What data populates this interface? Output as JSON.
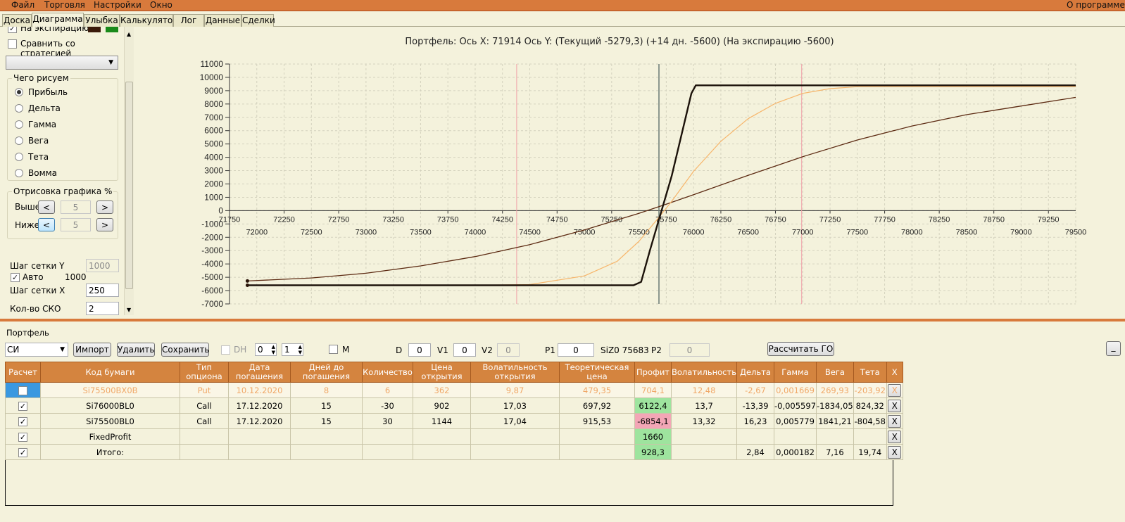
{
  "menu": {
    "file": "Файл",
    "trade": "Торговля",
    "settings": "Настройки",
    "window": "Окно",
    "about": "О программе"
  },
  "tabs": [
    "Доска",
    "Диаграмма",
    "Улыбка",
    "Калькулятор",
    "Лог",
    "Данные",
    "Сделки"
  ],
  "left": {
    "expiry_label": "На экспирацию",
    "compare_label": "Сравнить со стратегией",
    "what_group": "Чего рисуем",
    "radios": [
      "Прибыль",
      "Дельта",
      "Гамма",
      "Вега",
      "Тета",
      "Вомма"
    ],
    "draw_group": "Отрисовка графика %",
    "above_label": "Выше",
    "above_value": "5",
    "below_label": "Ниже",
    "below_value": "5",
    "prev": "<",
    "next": ">",
    "grid_y_label": "Шаг сетки Y",
    "grid_y_value": "1000",
    "auto_label": "Авто",
    "auto_value": "1000",
    "grid_x_label": "Шаг сетки X",
    "grid_x_value": "250",
    "sko_label": "Кол-во СКО",
    "sko_value": "2",
    "color_dark": "#3a1a0a",
    "color_green": "#1a8a1a"
  },
  "chart_title": "Портфель: Ось X: 71914 Ось Y:  (Текущий -5279,3)  (+14 дн. -5600)  (На экспирацию -5600)",
  "chart_data": {
    "type": "line",
    "xlim": [
      71750,
      79500
    ],
    "ylim": [
      -7000,
      11000
    ],
    "grid": true,
    "x_ticks_top": [
      "71750",
      "72250",
      "72750",
      "73250",
      "73750",
      "74250",
      "74750",
      "75250",
      "75750",
      "76250",
      "76750",
      "77250",
      "77750",
      "78250",
      "78750",
      "79250"
    ],
    "x_ticks_bottom": [
      "72000",
      "72500",
      "73000",
      "73500",
      "74000",
      "74500",
      "75000",
      "75500",
      "76000",
      "76500",
      "77000",
      "77500",
      "78000",
      "78500",
      "79000",
      "79500"
    ],
    "y_ticks": [
      "11000",
      "10000",
      "9000",
      "8000",
      "7000",
      "6000",
      "5000",
      "4000",
      "3000",
      "2000",
      "1000",
      "0",
      "-1000",
      "-2000",
      "-3000",
      "-4000",
      "-5000",
      "-6000",
      "-7000"
    ],
    "markers": {
      "current_x": 75683,
      "sko_low": 74380,
      "sko_high": 76990
    },
    "series": [
      {
        "color": "#5c2a12",
        "width": 1.3,
        "points": [
          [
            71914,
            -5279
          ],
          [
            72500,
            -5050
          ],
          [
            73000,
            -4700
          ],
          [
            73500,
            -4150
          ],
          [
            74000,
            -3450
          ],
          [
            74500,
            -2550
          ],
          [
            75000,
            -1450
          ],
          [
            75500,
            -200
          ],
          [
            75750,
            480
          ],
          [
            76000,
            1200
          ],
          [
            76500,
            2650
          ],
          [
            77000,
            4050
          ],
          [
            77500,
            5300
          ],
          [
            78000,
            6350
          ],
          [
            78500,
            7200
          ],
          [
            79000,
            7850
          ],
          [
            79500,
            8500
          ]
        ]
      },
      {
        "color": "#f7b56a",
        "width": 1.2,
        "points": [
          [
            71914,
            -5600
          ],
          [
            74000,
            -5600
          ],
          [
            74500,
            -5550
          ],
          [
            75000,
            -4900
          ],
          [
            75300,
            -3800
          ],
          [
            75500,
            -2300
          ],
          [
            75683,
            -500
          ],
          [
            75800,
            700
          ],
          [
            76000,
            2950
          ],
          [
            76250,
            5200
          ],
          [
            76500,
            6900
          ],
          [
            76750,
            8050
          ],
          [
            77000,
            8800
          ],
          [
            77250,
            9150
          ],
          [
            77500,
            9300
          ],
          [
            79500,
            9300
          ]
        ]
      },
      {
        "color": "#1c120a",
        "width": 2.4,
        "points": [
          [
            71914,
            -5600
          ],
          [
            75450,
            -5600
          ],
          [
            75520,
            -5350
          ],
          [
            75600,
            -3000
          ],
          [
            75800,
            2600
          ],
          [
            75980,
            8800
          ],
          [
            76020,
            9400
          ],
          [
            79500,
            9400
          ]
        ]
      }
    ],
    "start_points": [
      {
        "x": 71914,
        "y": -5279
      },
      {
        "x": 71914,
        "y": -5600
      }
    ]
  },
  "portfolio": {
    "label": "Портфель",
    "instrument": "СИ",
    "import": "Импорт",
    "delete": "Удалить",
    "save": "Сохранить",
    "dh": "DH",
    "dh_a": "0",
    "dh_b": "1",
    "m": "M",
    "d_label": "D",
    "d_value": "0",
    "v1_label": "V1",
    "v1_value": "0",
    "v2_label": "V2",
    "v2_value": "0",
    "p1_label": "P1",
    "p1_value": "0",
    "siz": "SiZ0 75683",
    "p2_label": "P2",
    "p2_value": "0",
    "calc_go": "Рассчитать ГО",
    "minimize": "_"
  },
  "table": {
    "headers": [
      "Расчет",
      "Код бумаги",
      "Тип опциона",
      "Дата погашения",
      "Дней до погашения",
      "Количество",
      "Цена открытия",
      "Волатильность открытия",
      "Теоретическая цена",
      "Профит",
      "Волатильность",
      "Дельта",
      "Гамма",
      "Вега",
      "Тета",
      "X"
    ],
    "rows": [
      {
        "checked": false,
        "cells": [
          "Si75500BX0B",
          "Put",
          "10.12.2020",
          "8",
          "6",
          "362",
          "9,87",
          "479,35",
          "704,1",
          "12,48",
          "-2,67",
          "0,001669",
          "269,93",
          "-203,92"
        ],
        "profit": "green"
      },
      {
        "checked": true,
        "cells": [
          "Si76000BL0",
          "Call",
          "17.12.2020",
          "15",
          "-30",
          "902",
          "17,03",
          "697,92",
          "6122,4",
          "13,7",
          "-13,39",
          "-0,005597",
          "-1834,05",
          "824,32"
        ],
        "profit": "green"
      },
      {
        "checked": true,
        "cells": [
          "Si75500BL0",
          "Call",
          "17.12.2020",
          "15",
          "30",
          "1144",
          "17,04",
          "915,53",
          "-6854,1",
          "13,32",
          "16,23",
          "0,005779",
          "1841,21",
          "-804,58"
        ],
        "profit": "pink"
      },
      {
        "checked": true,
        "cells": [
          "FixedProfit",
          "",
          "",
          "",
          "",
          "",
          "",
          "",
          "1660",
          "",
          "",
          "",
          "",
          ""
        ],
        "profit": "green"
      },
      {
        "checked": true,
        "cells": [
          "Итого:",
          "",
          "",
          "",
          "",
          "",
          "",
          "",
          "928,3",
          "",
          "2,84",
          "0,000182",
          "7,16",
          "19,74"
        ],
        "profit": "green"
      }
    ],
    "x_label": "X"
  }
}
